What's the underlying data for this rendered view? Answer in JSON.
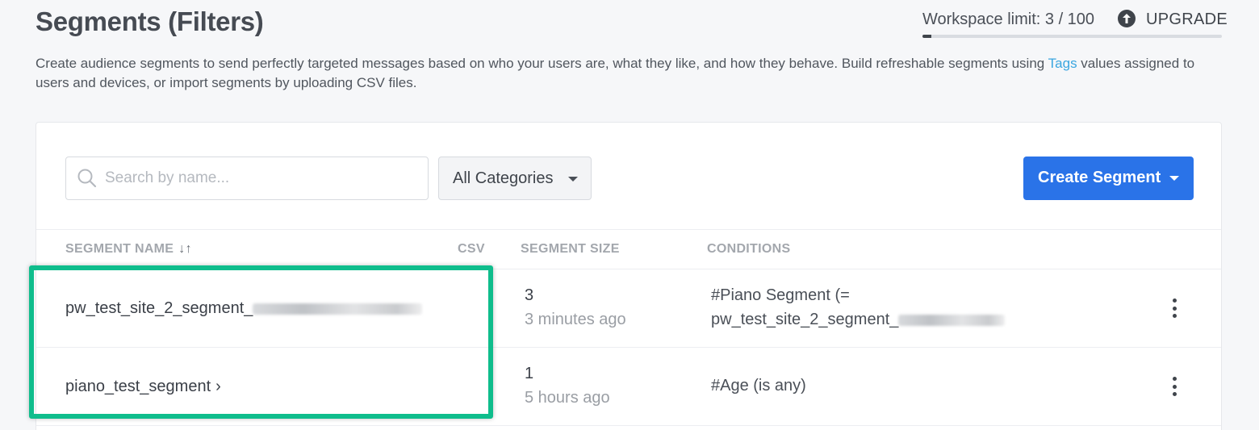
{
  "header": {
    "title": "Segments (Filters)",
    "limit_text": "Workspace limit: 3 / 100",
    "upgrade_label": "UPGRADE",
    "limit_fraction": 0.03,
    "description_before": "Create audience segments to send perfectly targeted messages based on who your users are, what they like, and how they behave. Build refreshable segments using ",
    "description_link": "Tags",
    "description_after": " values assigned to users and devices, or import segments by uploading CSV files."
  },
  "toolbar": {
    "search_placeholder": "Search by name...",
    "category_label": "All Categories",
    "create_label": "Create Segment"
  },
  "table": {
    "columns": {
      "name": "SEGMENT NAME",
      "csv": "CSV",
      "size": "SEGMENT SIZE",
      "conditions": "CONDITIONS"
    },
    "rows": [
      {
        "name": "pw_test_site_2_segment_",
        "size": "3",
        "updated": "3 minutes ago",
        "condition_line1": "#Piano Segment (=",
        "condition_line2": "pw_test_site_2_segment_"
      },
      {
        "name": "piano_test_segment",
        "size": "1",
        "updated": "5 hours ago",
        "condition_line1": "#Age (is any)",
        "condition_line2": ""
      }
    ]
  },
  "colors": {
    "primary": "#2a73e8",
    "link": "#3aa6e0",
    "highlight": "#0fbd8c"
  }
}
